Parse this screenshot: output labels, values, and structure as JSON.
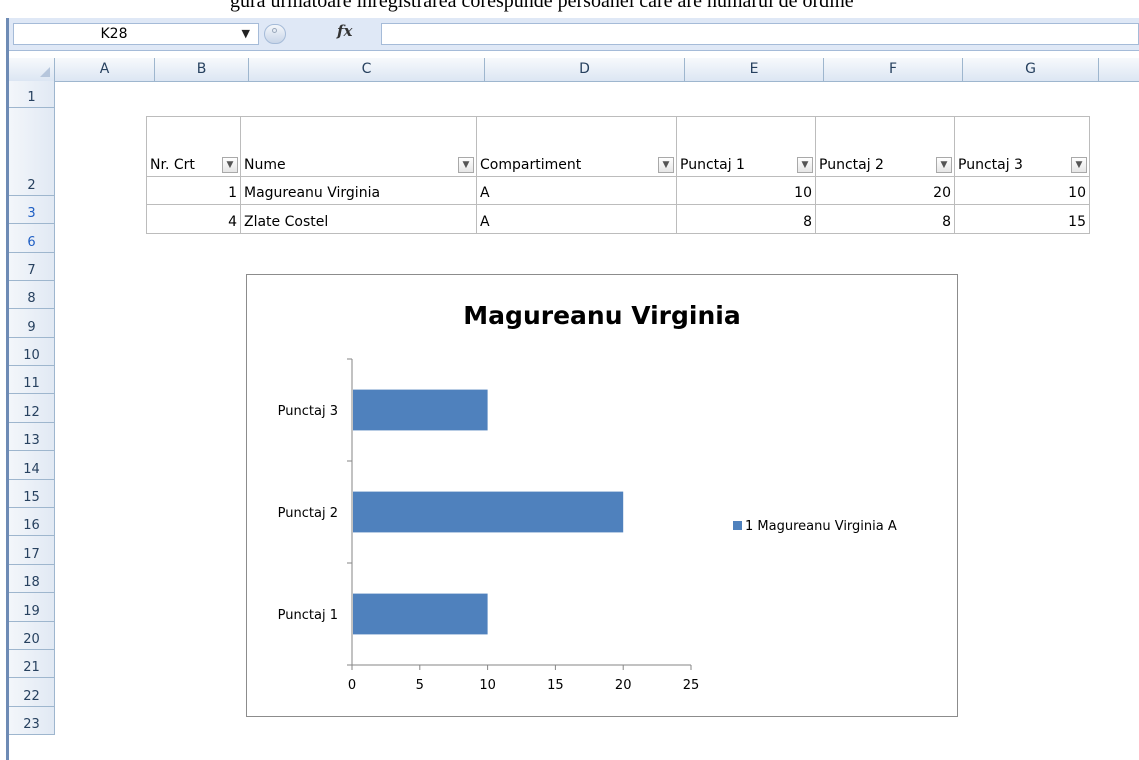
{
  "caption": "gura urmatoare inregistrarea corespunde persoanei care are numarul de ordine",
  "namebox": {
    "value": "K28"
  },
  "formula": {
    "fx_label": "fx",
    "value": ""
  },
  "columns": [
    "A",
    "B",
    "C",
    "D",
    "E",
    "F",
    "G"
  ],
  "rows": [
    "1",
    "2",
    "3",
    "6",
    "7",
    "8",
    "9",
    "10",
    "11",
    "12",
    "13",
    "14",
    "15",
    "16",
    "17",
    "18",
    "19",
    "20",
    "21",
    "22",
    "23"
  ],
  "table": {
    "headers": [
      "Nr. Crt",
      "Nume",
      "Compartiment",
      "Punctaj 1",
      "Punctaj 2",
      "Punctaj 3"
    ],
    "rows": [
      [
        "1",
        "Magureanu Virginia",
        "A",
        "10",
        "20",
        "10"
      ],
      [
        "4",
        "Zlate Costel",
        "A",
        "8",
        "8",
        "15"
      ]
    ]
  },
  "chart_data": {
    "type": "bar",
    "orientation": "horizontal",
    "title": "Magureanu Virginia",
    "categories": [
      "Punctaj 1",
      "Punctaj 2",
      "Punctaj 3"
    ],
    "series": [
      {
        "name": "1 Magureanu Virginia A",
        "values": [
          10,
          20,
          10
        ],
        "color": "#4f81bd"
      }
    ],
    "xlim": [
      0,
      25
    ],
    "xticks": [
      0,
      5,
      10,
      15,
      20,
      25
    ],
    "grid": false,
    "legend": "right"
  }
}
